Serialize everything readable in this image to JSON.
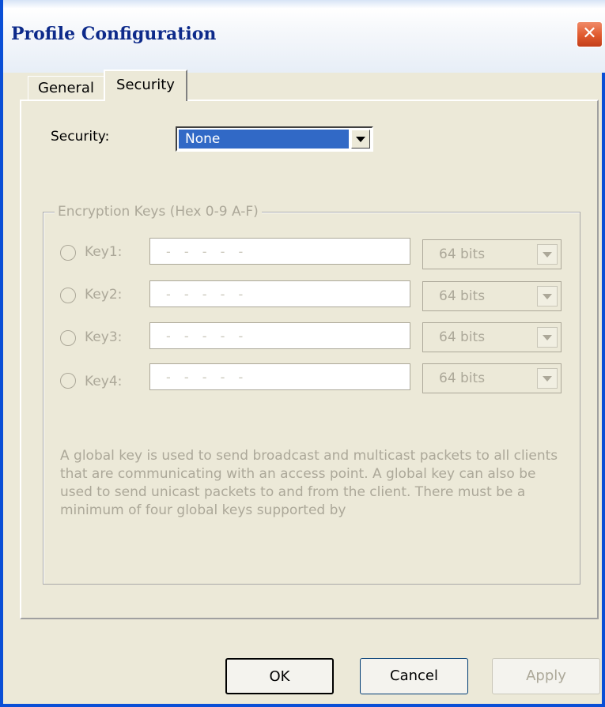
{
  "window": {
    "title": "Profile Configuration",
    "close_glyph": "✕"
  },
  "tabs": [
    {
      "label": "General",
      "active": false
    },
    {
      "label": "Security",
      "active": true
    }
  ],
  "security": {
    "label": "Security:",
    "value": "None"
  },
  "encryption": {
    "legend": "Encryption Keys (Hex 0-9 A-F)",
    "keys": [
      {
        "label": "Key1:",
        "mask": "- - - - -",
        "bits": "64 bits"
      },
      {
        "label": "Key2:",
        "mask": "- - - - -",
        "bits": "64 bits"
      },
      {
        "label": "Key3:",
        "mask": "- - - - -",
        "bits": "64 bits"
      },
      {
        "label": "Key4:",
        "mask": "- - - - -",
        "bits": "64 bits"
      }
    ],
    "note": "A global key is used to send broadcast and multicast packets to all clients that are communicating with an access point. A global key can also be used to send unicast packets to and from the client. There must be a minimum of four global keys supported by"
  },
  "buttons": {
    "ok": "OK",
    "cancel": "Cancel",
    "apply": "Apply"
  }
}
